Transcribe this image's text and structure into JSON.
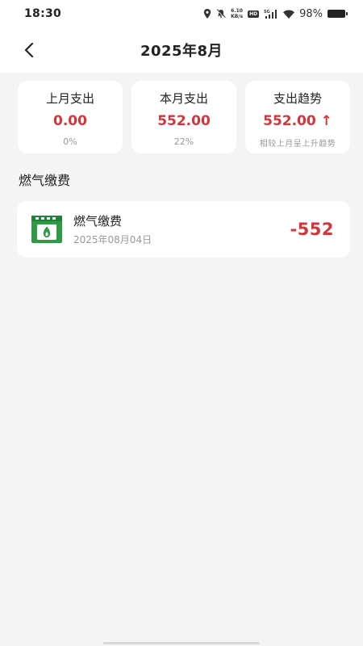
{
  "status_bar": {
    "time": "18:30",
    "net_speed_value": "6.10",
    "net_speed_unit": "KB/s",
    "hd_label": "HD",
    "network_label": "5G",
    "battery": "98%"
  },
  "nav": {
    "title": "2025年8月"
  },
  "summary": [
    {
      "label": "上月支出",
      "value": "0.00",
      "sub": "0%"
    },
    {
      "label": "本月支出",
      "value": "552.00",
      "sub": "22%"
    },
    {
      "label": "支出趋势",
      "value": "552.00",
      "trend_arrow": "↑",
      "sub": "相较上月呈上升趋势"
    }
  ],
  "section": {
    "title": "燃气缴费"
  },
  "records": [
    {
      "name": "燃气缴费",
      "date": "2025年08月04日",
      "amount": "-552",
      "icon": "gas-stove-icon"
    }
  ],
  "colors": {
    "accent_red": "#d0363b",
    "icon_green": "#2f9a44",
    "background": "#f4f4f4"
  }
}
